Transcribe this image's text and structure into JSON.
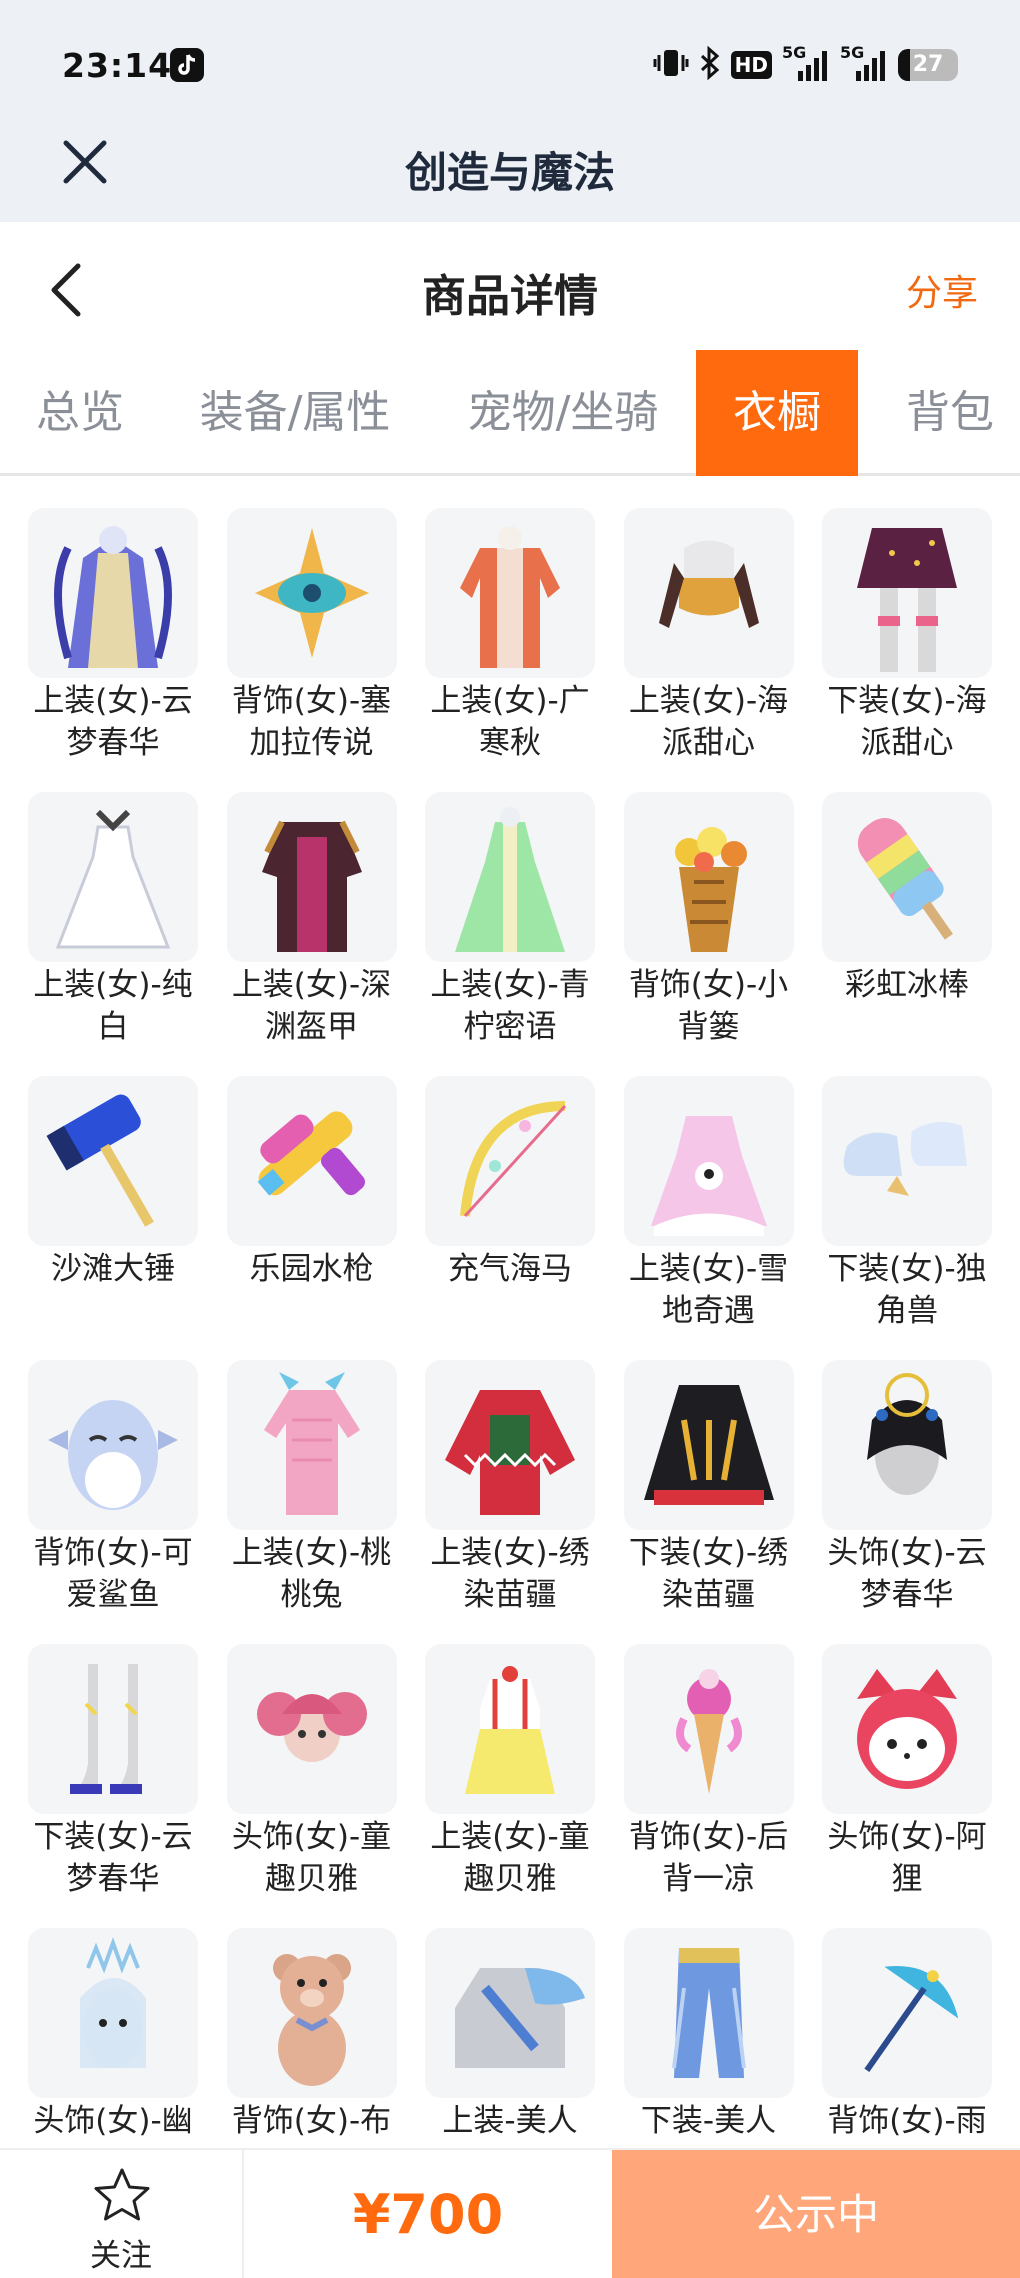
{
  "status_bar": {
    "time": "23:14",
    "network": "HD",
    "signal1": "5G",
    "signal2": "5G",
    "battery": "27"
  },
  "app_bar": {
    "title": "创造与魔法"
  },
  "header": {
    "title": "商品详情",
    "share": "分享"
  },
  "tabs": [
    {
      "label": "总览"
    },
    {
      "label": "装备/属性"
    },
    {
      "label": "宠物/坐骑"
    },
    {
      "label": "衣橱"
    },
    {
      "label": "背包"
    }
  ],
  "active_tab": "衣橱",
  "items": [
    {
      "name": "上装(女)-云梦春华",
      "icon": "purple-gown-icon"
    },
    {
      "name": "背饰(女)-塞加拉传说",
      "icon": "golden-eye-icon"
    },
    {
      "name": "上装(女)-广寒秋",
      "icon": "red-robe-icon"
    },
    {
      "name": "上装(女)-海派甜心",
      "icon": "sweet-top-icon"
    },
    {
      "name": "下装(女)-海派甜心",
      "icon": "sequin-skirt-icon"
    },
    {
      "name": "上装(女)-纯白",
      "icon": "white-dress-icon"
    },
    {
      "name": "上装(女)-深渊盔甲",
      "icon": "dark-armor-icon"
    },
    {
      "name": "上装(女)-青柠密语",
      "icon": "green-dress-icon"
    },
    {
      "name": "背饰(女)-小背篓",
      "icon": "flower-basket-icon"
    },
    {
      "name": "彩虹冰棒",
      "icon": "rainbow-popsicle-icon"
    },
    {
      "name": "沙滩大锤",
      "icon": "hammer-icon"
    },
    {
      "name": "乐园水枪",
      "icon": "water-gun-icon"
    },
    {
      "name": "充气海马",
      "icon": "bow-icon"
    },
    {
      "name": "上装(女)-雪地奇遇",
      "icon": "snow-dress-icon"
    },
    {
      "name": "下装(女)-独角兽",
      "icon": "unicorn-boots-icon"
    },
    {
      "name": "背饰(女)-可爱鲨鱼",
      "icon": "shark-icon"
    },
    {
      "name": "上装(女)-桃桃兔",
      "icon": "pink-dress-icon"
    },
    {
      "name": "上装(女)-绣染苗疆",
      "icon": "embroidered-top-icon"
    },
    {
      "name": "下装(女)-绣染苗疆",
      "icon": "embroidered-skirt-icon"
    },
    {
      "name": "头饰(女)-云梦春华",
      "icon": "headdress-icon"
    },
    {
      "name": "下装(女)-云梦春华",
      "icon": "heels-icon"
    },
    {
      "name": "头饰(女)-童趣贝雅",
      "icon": "pink-hair-icon"
    },
    {
      "name": "上装(女)-童趣贝雅",
      "icon": "yellow-dress-icon"
    },
    {
      "name": "背饰(女)-后背一凉",
      "icon": "ice-cream-icon"
    },
    {
      "name": "头饰(女)-阿狸",
      "icon": "fox-head-icon"
    },
    {
      "name": "头饰(女)-幽",
      "icon": "ice-crown-icon"
    },
    {
      "name": "背饰(女)-布",
      "icon": "teddy-bear-icon"
    },
    {
      "name": "上装-美人",
      "icon": "blue-armor-icon"
    },
    {
      "name": "下装-美人",
      "icon": "blue-pants-icon"
    },
    {
      "name": "背饰(女)-雨",
      "icon": "umbrella-icon"
    }
  ],
  "bottom": {
    "follow": "关注",
    "price": "¥700",
    "status": "公示中"
  }
}
